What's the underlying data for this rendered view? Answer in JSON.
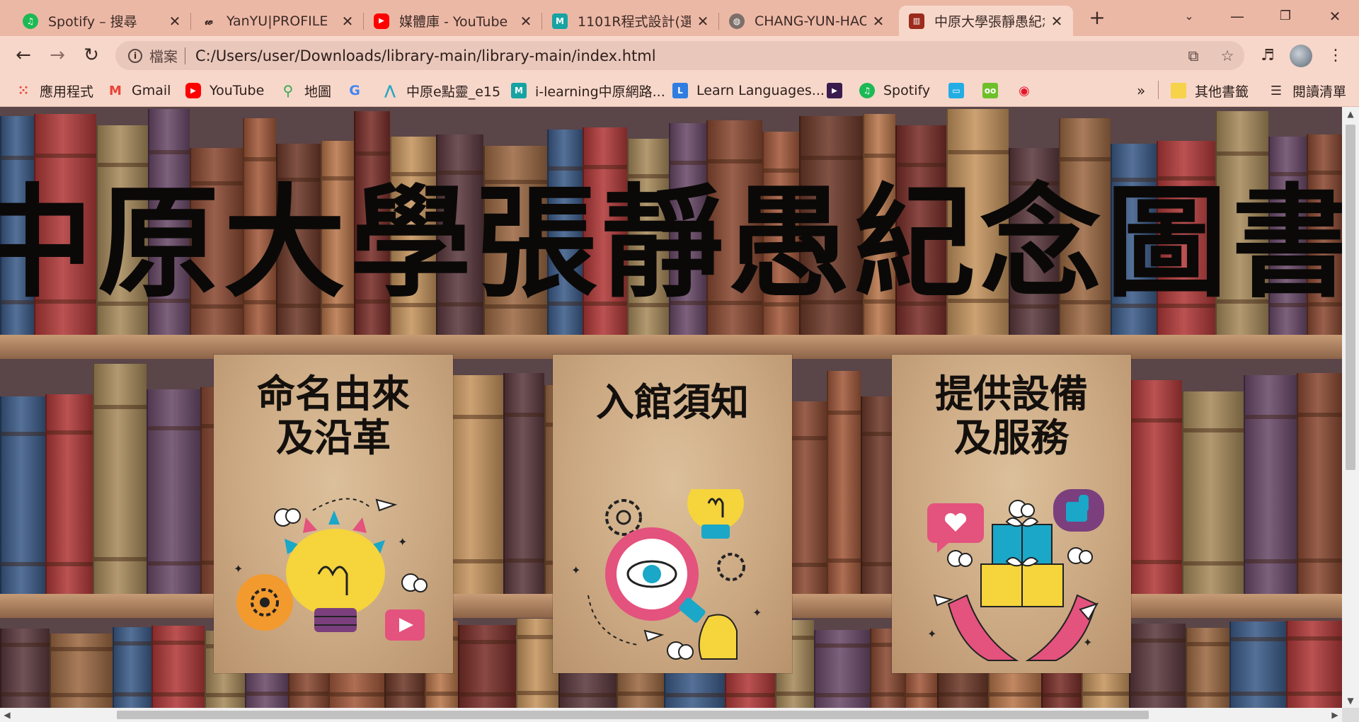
{
  "tabs": [
    {
      "title": "Spotify – 搜尋",
      "icon": "spotify-icon"
    },
    {
      "title": "YanYU|PROFILE",
      "icon": "signature-icon"
    },
    {
      "title": "媒體庫 - YouTube",
      "icon": "youtube-icon"
    },
    {
      "title": "1101R程式設計(選",
      "icon": "m-logo-icon"
    },
    {
      "title": "CHANG-YUN-HAO",
      "icon": "globe-icon"
    },
    {
      "title": "中原大學張靜愚紀念",
      "icon": "books-icon",
      "active": true
    }
  ],
  "toolbar": {
    "address_label": "檔案",
    "url": "C:/Users/user/Downloads/library-main/library-main/index.html"
  },
  "bookmarks": [
    {
      "label": "應用程式",
      "icon": "apps-grid-icon"
    },
    {
      "label": "Gmail",
      "icon": "gmail-icon"
    },
    {
      "label": "YouTube",
      "icon": "youtube-icon"
    },
    {
      "label": "地圖",
      "icon": "maps-pin-icon"
    },
    {
      "label": "",
      "icon": "google-icon"
    },
    {
      "label": "中原e點靈_e15",
      "icon": "e15-icon"
    },
    {
      "label": "i-learning中原網路...",
      "icon": "m-logo-icon"
    },
    {
      "label": "Learn Languages...",
      "icon": "lingq-icon"
    },
    {
      "label": "",
      "icon": "play-icon"
    },
    {
      "label": "Spotify",
      "icon": "spotify-icon"
    },
    {
      "label": "",
      "icon": "bilibili-icon"
    },
    {
      "label": "",
      "icon": "owl-icon"
    },
    {
      "label": "",
      "icon": "weibo-icon"
    }
  ],
  "bookmarks_overflow": "»",
  "other_bookmarks": "其他書籤",
  "reading_list": "閱讀清單",
  "page": {
    "banner_title": "中原大學張靜愚紀念圖書館",
    "cards": [
      {
        "title_line1": "命名由來",
        "title_line2": "及沿革"
      },
      {
        "title_line1": "入館須知",
        "title_line2": ""
      },
      {
        "title_line1": "提供設備",
        "title_line2": "及服務"
      }
    ]
  },
  "colors": {
    "tab_strip": "#ecb8a6",
    "toolbar": "#f7d7ca",
    "card_paper": "#d2b28c",
    "accent_pink": "#e4527e",
    "accent_yellow": "#f5d43c",
    "accent_cyan": "#1aa7c8",
    "accent_orange": "#f29a2e",
    "accent_purple": "#7b3f7d"
  }
}
